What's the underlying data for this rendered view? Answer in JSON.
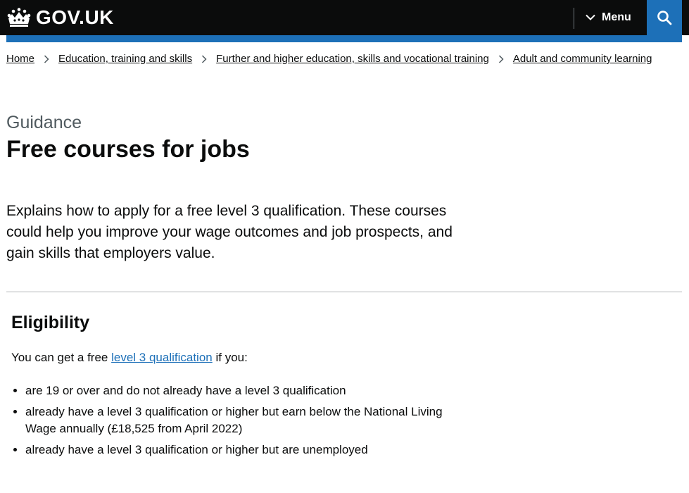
{
  "header": {
    "logo_text": "GOV.UK",
    "menu_label": "Menu",
    "colors": {
      "header_bg": "#0b0c0c",
      "accent_blue": "#1d70b8"
    }
  },
  "breadcrumbs": [
    "Home",
    "Education, training and skills",
    "Further and higher education, skills and vocational training",
    "Adult and community learning"
  ],
  "page": {
    "caption": "Guidance",
    "title": "Free courses for jobs",
    "lead": "Explains how to apply for a free level 3 qualification. These courses could help you improve your wage outcomes and job prospects, and gain skills that employers value."
  },
  "eligibility": {
    "heading": "Eligibility",
    "intro_before": "You can get a free ",
    "intro_link": "level 3 qualification",
    "intro_after": " if you:",
    "items": [
      "are 19 or over and do not already have a level 3 qualification",
      "already have a level 3 qualification or higher but earn below the National Living Wage annually (£18,525 from April 2022)",
      "already have a level 3 qualification or higher but are unemployed"
    ]
  },
  "icons": {
    "logo": "crown-icon",
    "menu": "chevron-down-icon",
    "search": "search-icon",
    "breadcrumb_separator": "chevron-right-icon"
  }
}
